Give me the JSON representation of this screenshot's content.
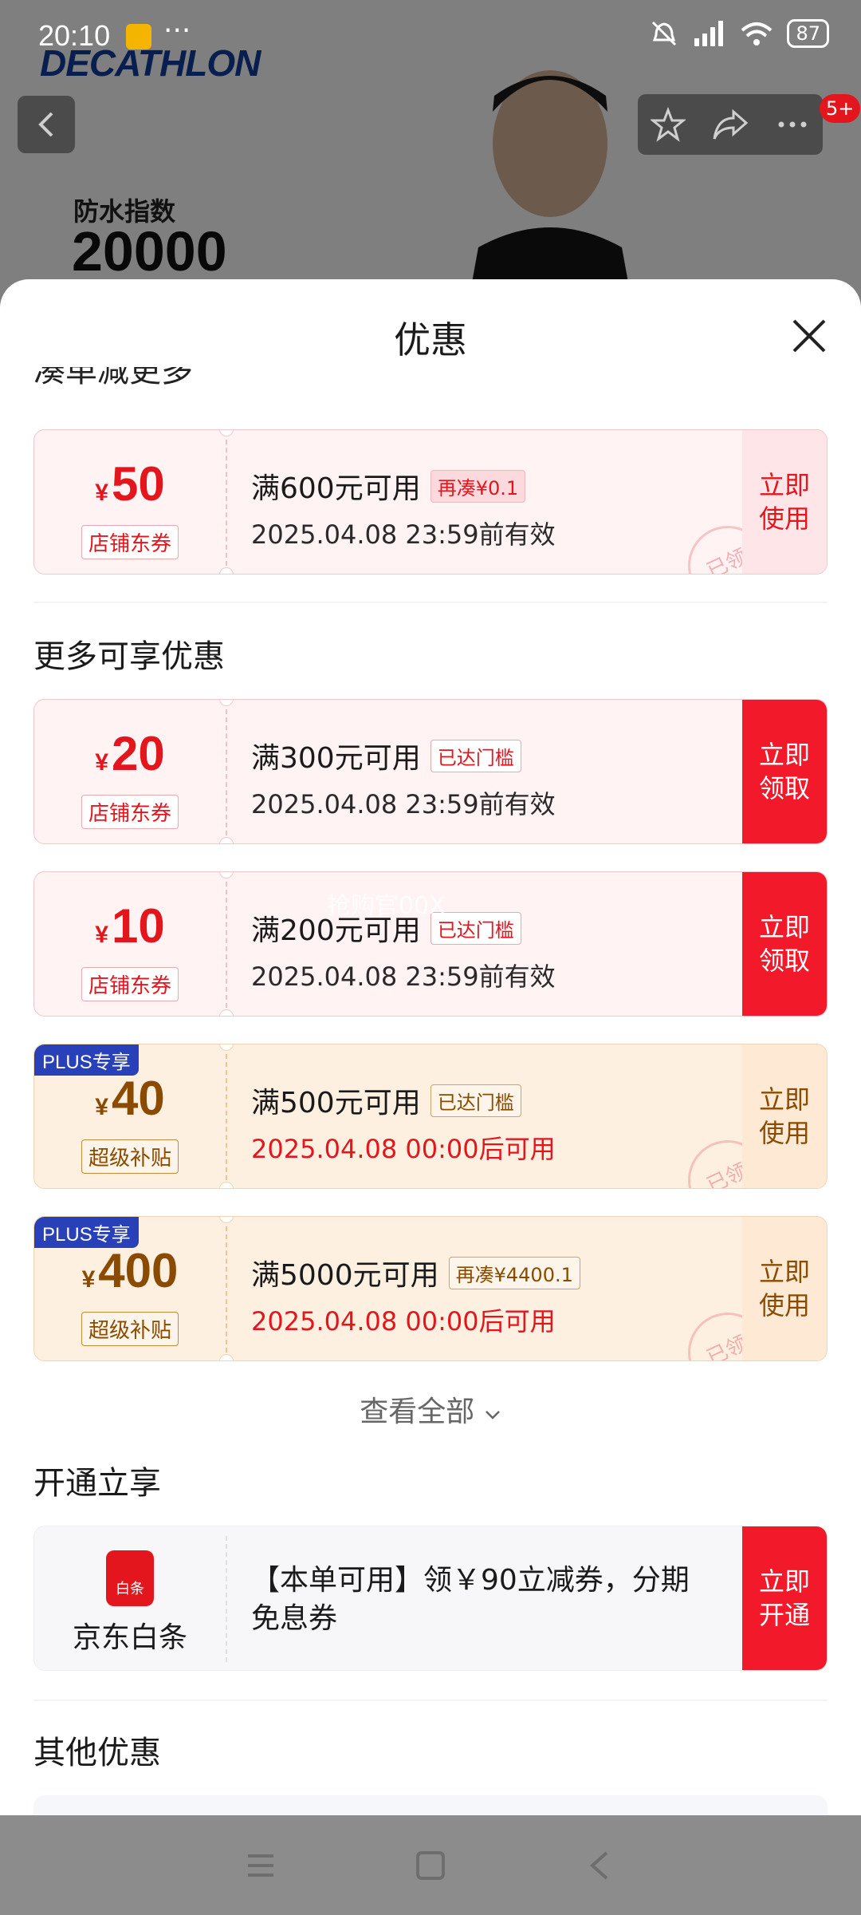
{
  "status_bar": {
    "time": "20:10",
    "more": "···",
    "battery": "87"
  },
  "background": {
    "brand": "DECATHLON",
    "metric_label": "防水指数",
    "metric_value": "20000",
    "badge": "5+"
  },
  "sheet": {
    "title": "优惠",
    "partial_heading": "凑单减更多",
    "more_section_title": "更多可享优惠",
    "view_all": "查看全部",
    "open_section_title": "开通立享",
    "other_section_title": "其他优惠"
  },
  "coupons": [
    {
      "amount": "50",
      "yen": "¥",
      "tag": "店铺东券",
      "condition": "满600元可用",
      "badge": "再凑¥0.1",
      "date": "2025.04.08 23:59前有效",
      "action": "立即\n使用",
      "stamp": "已领"
    },
    {
      "amount": "20",
      "yen": "¥",
      "tag": "店铺东券",
      "condition": "满300元可用",
      "badge": "已达门槛",
      "date": "2025.04.08 23:59前有效",
      "action": "立即\n领取"
    },
    {
      "amount": "10",
      "yen": "¥",
      "tag": "店铺东券",
      "condition": "满200元可用",
      "badge": "已达门槛",
      "date": "2025.04.08 23:59前有效",
      "action": "立即\n领取"
    },
    {
      "ribbon": "PLUS专享",
      "amount": "40",
      "yen": "¥",
      "tag": "超级补贴",
      "condition": "满500元可用",
      "badge": "已达门槛",
      "date": "2025.04.08 00:00后可用",
      "action": "立即\n使用",
      "stamp": "已领"
    },
    {
      "ribbon": "PLUS专享",
      "amount": "400",
      "yen": "¥",
      "tag": "超级补贴",
      "condition": "满5000元可用",
      "badge": "再凑¥4400.1",
      "date": "2025.04.08 00:00后可用",
      "action": "立即\n使用",
      "stamp": "已领"
    }
  ],
  "baitiao": {
    "logo_text": "白条",
    "name": "京东白条",
    "text": "【本单可用】领￥90立减券，分期免息券",
    "action": "立即\n开通"
  },
  "watermark": "抢购官00X",
  "colors": {
    "accent_red": "#e4161d",
    "plus_blue": "#2840b8",
    "plus_gold": "#8a4b00"
  }
}
